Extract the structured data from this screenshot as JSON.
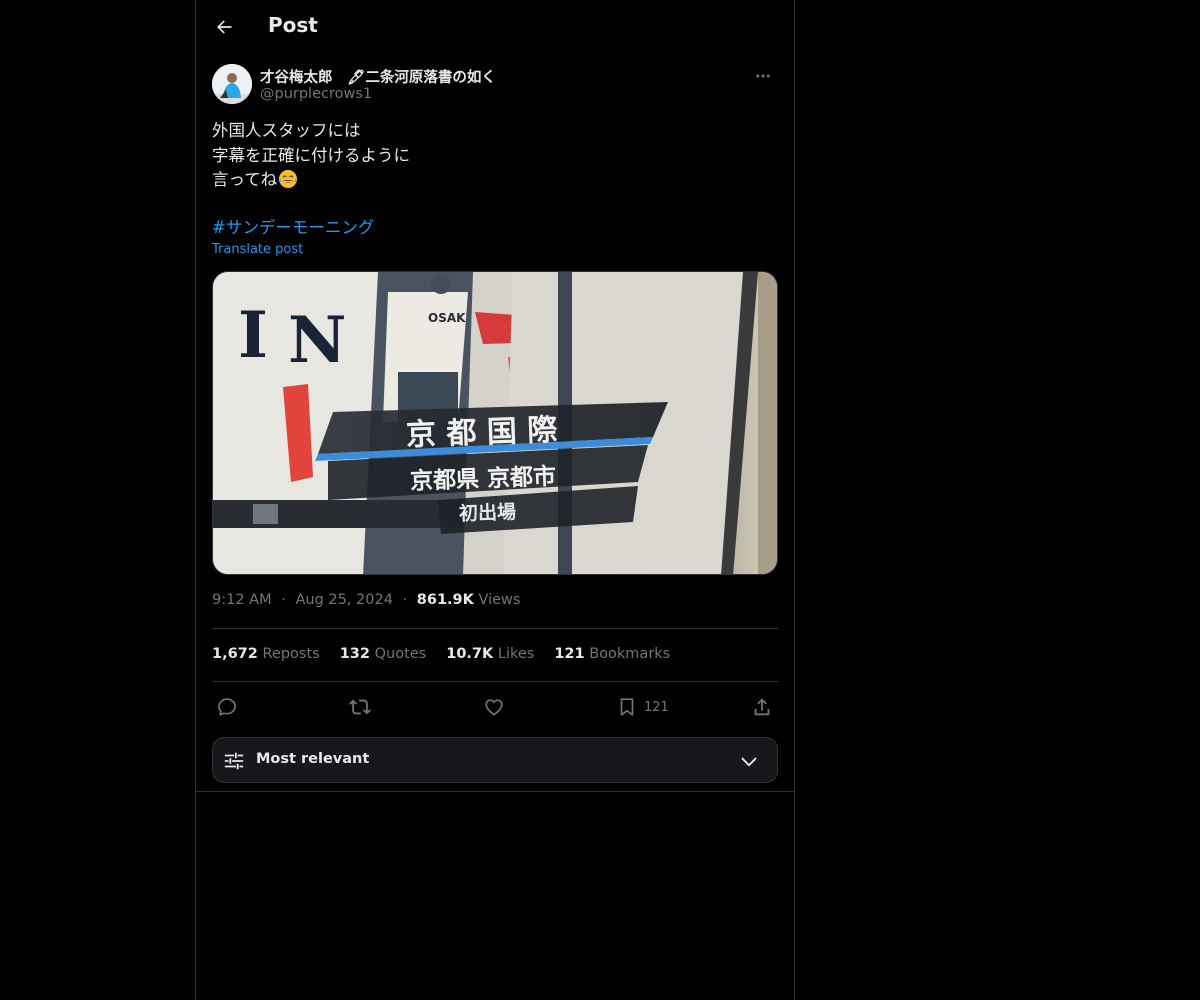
{
  "header": {
    "title": "Post"
  },
  "author": {
    "display_name": "才谷梅太郎　🖋二条河原落書の如く",
    "handle": "@purplecrows1"
  },
  "tweet": {
    "lines": [
      "外国人スタッフには",
      "字幕を正確に付けるように",
      "言ってね"
    ],
    "emoji": "😂",
    "hashtag": "#サンデーモーニング",
    "translate_label": "Translate post",
    "media": {
      "chyron_title": "京 都 国 際",
      "chyron_location": "京都県 京都市",
      "chyron_note": "初出場",
      "jersey_text": "OSAKA",
      "jersey_letters": "IN"
    }
  },
  "meta": {
    "time": "9:12 AM",
    "sep": "·",
    "date": "Aug 25, 2024",
    "views_count": "861.9K",
    "views_label": "Views"
  },
  "stats": {
    "reposts": {
      "num": "1,672",
      "label": "Reposts"
    },
    "quotes": {
      "num": "132",
      "label": "Quotes"
    },
    "likes": {
      "num": "10.7K",
      "label": "Likes"
    },
    "bookmarks": {
      "num": "121",
      "label": "Bookmarks"
    }
  },
  "actions": {
    "bookmark_count": "121"
  },
  "sort": {
    "label": "Most relevant"
  },
  "colors": {
    "accent": "#1d9bf0",
    "muted": "#71767b",
    "text": "#e7e9ea",
    "border": "#2f3336",
    "background": "#000000"
  }
}
